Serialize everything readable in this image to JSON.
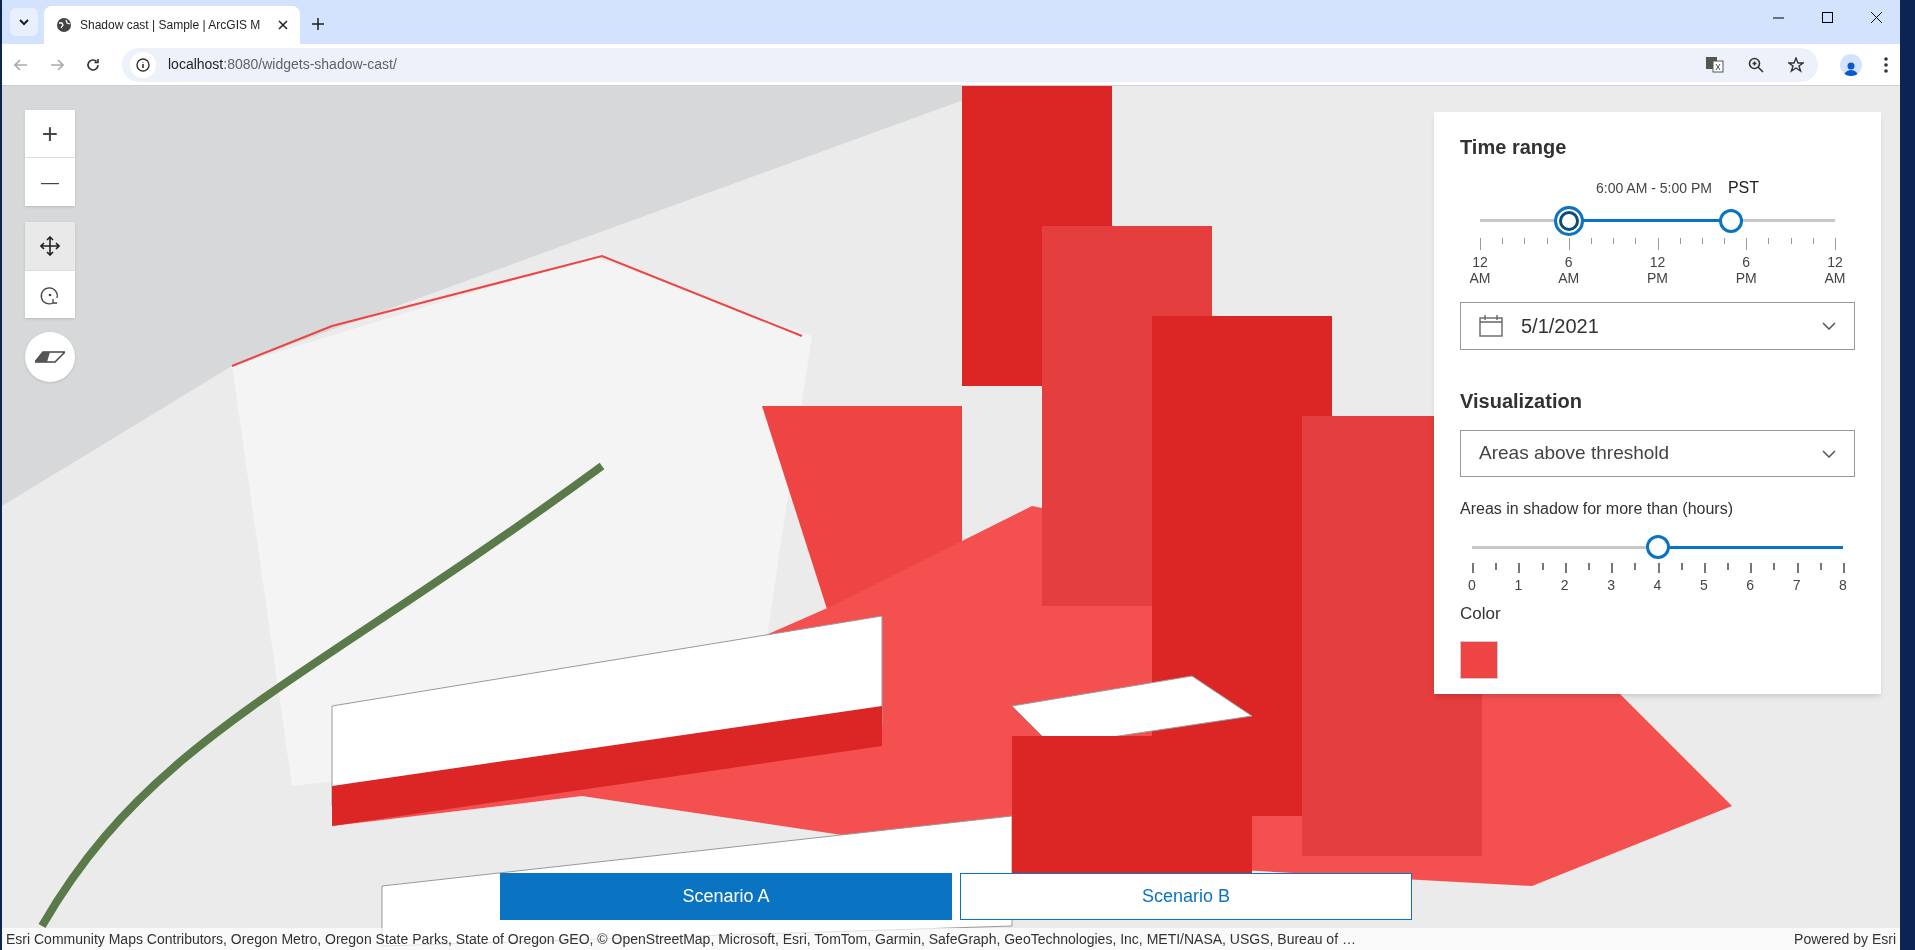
{
  "browser": {
    "tab": {
      "title": "Shadow cast | Sample | ArcGIS M"
    },
    "url": {
      "host": "localhost",
      "rest": ":8080/widgets-shadow-cast/"
    }
  },
  "map_controls": {
    "zoom": [
      "+",
      "—"
    ],
    "nav_modes": [
      {
        "kind": "pan",
        "selected": true
      },
      {
        "kind": "rotate",
        "selected": false
      }
    ]
  },
  "panel": {
    "time_range": {
      "title": "Time range",
      "range_label": "6:00 AM - 5:00 PM",
      "timezone": "PST",
      "handles": [
        {
          "level": 0.25
        },
        {
          "level": 0.708
        }
      ],
      "ticks": [
        [
          "12",
          "AM"
        ],
        [
          "6",
          "AM"
        ],
        [
          "12",
          "PM"
        ],
        [
          "6",
          "PM"
        ],
        [
          "12",
          "AM"
        ]
      ],
      "date": "5/1/2021"
    },
    "visualization": {
      "title": "Visualization",
      "selected_option": "Areas above threshold",
      "threshold_label": "Areas in shadow for more than (hours)",
      "level": 0.5,
      "ticks": [
        "0",
        "1",
        "2",
        "3",
        "4",
        "5",
        "6",
        "7",
        "8"
      ],
      "color_label": "Color",
      "color": "#ef4444"
    }
  },
  "scenarios": [
    {
      "label": "Scenario A",
      "selected": true
    },
    {
      "label": "Scenario B",
      "selected": false
    }
  ],
  "attribution": {
    "text": "Esri Community Maps Contributors, Oregon Metro, Oregon State Parks, State of Oregon GEO, © OpenStreetMap, Microsoft, Esri, TomTom, Garmin, SafeGraph, GeoTechnologies, Inc, METI/NASA, USGS, Bureau of …",
    "powered_by": "Powered by Esri"
  }
}
